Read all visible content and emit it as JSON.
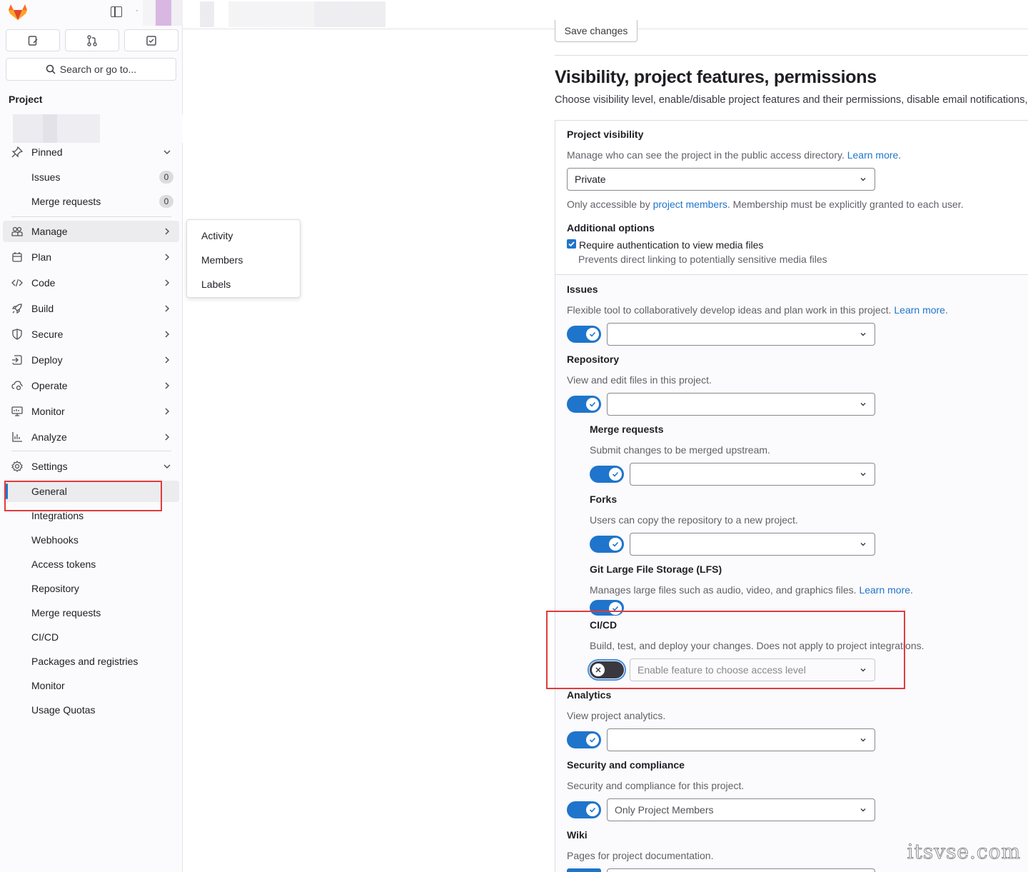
{
  "sidebar": {
    "search_label": "Search or go to...",
    "section_title": "Project",
    "pinned": {
      "label": "Pinned",
      "items": [
        {
          "label": "Issues",
          "count": "0"
        },
        {
          "label": "Merge requests",
          "count": "0"
        }
      ]
    },
    "nav": {
      "manage": "Manage",
      "plan": "Plan",
      "code": "Code",
      "build": "Build",
      "secure": "Secure",
      "deploy": "Deploy",
      "operate": "Operate",
      "monitor": "Monitor",
      "analyze": "Analyze",
      "settings": "Settings"
    },
    "settings_items": [
      "General",
      "Integrations",
      "Webhooks",
      "Access tokens",
      "Repository",
      "Merge requests",
      "CI/CD",
      "Packages and registries",
      "Monitor",
      "Usage Quotas"
    ]
  },
  "flyout": {
    "items": [
      "Activity",
      "Members",
      "Labels"
    ]
  },
  "main": {
    "save_label": "Save changes",
    "section_title": "Visibility, project features, permissions",
    "section_desc": "Choose visibility level, enable/disable project features and their permissions, disable email notifications, and show default emoji reactions.",
    "visibility": {
      "label": "Project visibility",
      "help": "Manage who can see the project in the public access directory.",
      "learn_more": "Learn more",
      "value": "Private",
      "note_prefix": "Only accessible by ",
      "note_link": "project members",
      "note_suffix": ". Membership must be explicitly granted to each user."
    },
    "additional": {
      "label": "Additional options",
      "checkbox_label": "Require authentication to view media files",
      "checkbox_help": "Prevents direct linking to potentially sensitive media files",
      "checked": true
    },
    "features": {
      "issues": {
        "label": "Issues",
        "help": "Flexible tool to collaboratively develop ideas and plan work in this project.",
        "learn_more": "Learn more",
        "enabled": true,
        "select": ""
      },
      "repository": {
        "label": "Repository",
        "help": "View and edit files in this project.",
        "enabled": true,
        "select": ""
      },
      "merge_requests": {
        "label": "Merge requests",
        "help": "Submit changes to be merged upstream.",
        "enabled": true,
        "select": ""
      },
      "forks": {
        "label": "Forks",
        "help": "Users can copy the repository to a new project.",
        "enabled": true,
        "select": ""
      },
      "lfs": {
        "label": "Git Large File Storage (LFS)",
        "help": "Manages large files such as audio, video, and graphics files.",
        "learn_more": "Learn more",
        "enabled": true
      },
      "cicd": {
        "label": "CI/CD",
        "help": "Build, test, and deploy your changes. Does not apply to project integrations.",
        "enabled": false,
        "select": "Enable feature to choose access level"
      },
      "analytics": {
        "label": "Analytics",
        "help": "View project analytics.",
        "enabled": true,
        "select": ""
      },
      "security": {
        "label": "Security and compliance",
        "help": "Security and compliance for this project.",
        "enabled": true,
        "select": "Only Project Members"
      },
      "wiki": {
        "label": "Wiki",
        "help": "Pages for project documentation."
      }
    }
  },
  "watermark": "itsvse.com",
  "colors": {
    "accent": "#1f75cb",
    "highlight": "#e03c3c"
  }
}
